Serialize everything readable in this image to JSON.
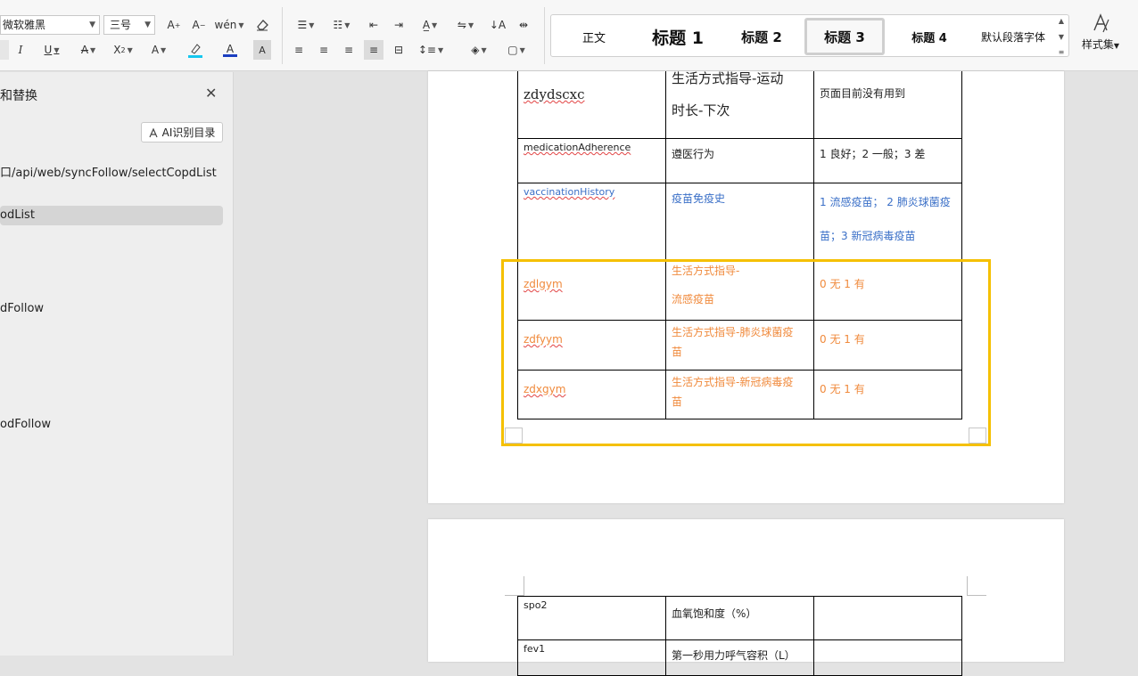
{
  "ribbon": {
    "font_name": "微软雅黑",
    "font_size": "三号",
    "style_gallery": {
      "items": [
        "正文",
        "标题 1",
        "标题 2",
        "标题 3",
        "标题 4",
        "默认段落字体"
      ],
      "selected": "标题 3"
    },
    "style_set_label": "样式集",
    "font_color": "#1a3ec0",
    "highlight_color": "#16c7ee"
  },
  "sidebar": {
    "title": "和替换",
    "ai_button_label": "AI识别目录",
    "items": [
      "口/api/web/syncFollow/selectCopdList",
      "odList",
      "dFollow",
      "odFollow"
    ]
  },
  "document": {
    "table1_rows": [
      {
        "field": "zdydscxc",
        "name_lines": [
          "生活方式指导-运动",
          "时长-下次"
        ],
        "values_lines": [
          "页面目前没有用到"
        ],
        "color": "black"
      },
      {
        "field": "medicationAdherence",
        "name_lines": [
          "遵医行为"
        ],
        "values_lines": [
          "1 良好；2 一般；3 差"
        ],
        "color": "black"
      },
      {
        "field": "vaccinationHistory",
        "name_lines": [
          "疫苗免疫史"
        ],
        "values_lines": [
          "1 流感疫苗； 2 肺炎球菌疫",
          "苗；3 新冠病毒疫苗"
        ],
        "color": "blue"
      },
      {
        "field": "zdlgym",
        "name_lines": [
          "生活方式指导-",
          "流感疫苗"
        ],
        "values_lines": [
          "0 无  1 有"
        ],
        "color": "orange"
      },
      {
        "field": "zdfyym",
        "name_lines": [
          "生活方式指导-肺炎球菌疫",
          "苗"
        ],
        "values_lines": [
          "0 无  1 有"
        ],
        "color": "orange"
      },
      {
        "field": "zdxgym",
        "name_lines": [
          "生活方式指导-新冠病毒疫",
          "苗"
        ],
        "values_lines": [
          "0 无  1 有"
        ],
        "color": "orange"
      }
    ],
    "table2_rows": [
      {
        "field": "spo2",
        "name_lines": [
          "血氧饱和度（%）"
        ],
        "values_lines": [
          ""
        ]
      },
      {
        "field": "fev1",
        "name_lines": [
          "第一秒用力呼气容积（L）"
        ],
        "values_lines": [
          ""
        ]
      }
    ]
  },
  "colors": {
    "highlight_box": "#f5c000",
    "blue_text": "#3a6fc7",
    "orange_text": "#f08a3c",
    "spellcheck": "#e24444"
  }
}
